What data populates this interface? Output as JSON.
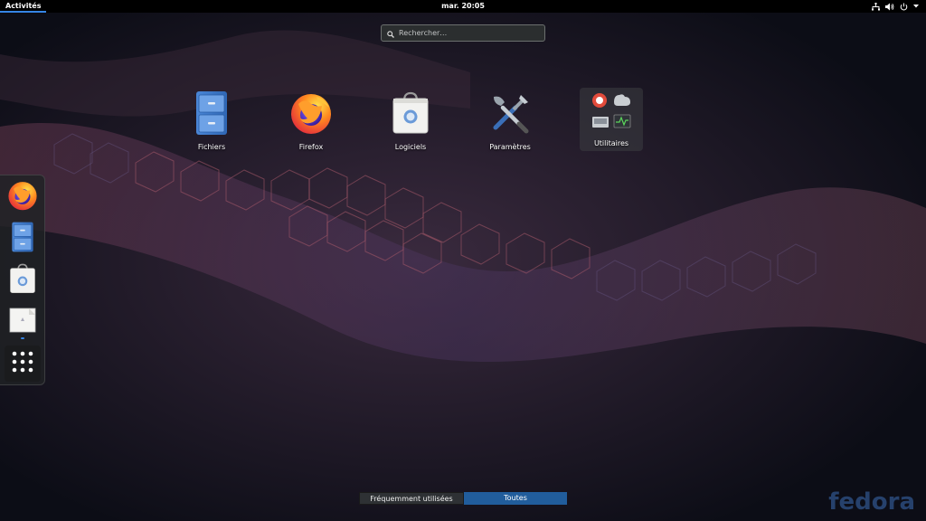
{
  "topbar": {
    "activities": "Activités",
    "clock": "mar. 20:05",
    "status_icons": [
      "network-icon",
      "volume-icon",
      "power-icon",
      "chevron-down-icon"
    ]
  },
  "search": {
    "placeholder": "Rechercher…"
  },
  "apps": [
    {
      "label": "Fichiers",
      "icon": "file-cabinet-icon"
    },
    {
      "label": "Firefox",
      "icon": "firefox-icon"
    },
    {
      "label": "Logiciels",
      "icon": "software-bag-icon"
    },
    {
      "label": "Paramètres",
      "icon": "tools-icon"
    },
    {
      "label": "Utilitaires",
      "icon": "folder-icon"
    }
  ],
  "dash": {
    "items": [
      "firefox-icon",
      "file-cabinet-icon",
      "software-bag-icon",
      "document-viewer-icon",
      "show-applications-icon"
    ]
  },
  "switcher": {
    "frequent": "Fréquemment utilisées",
    "all": "Toutes",
    "selected": "Toutes"
  },
  "watermark": "fedora",
  "colors": {
    "accent": "#3584e4",
    "selected_tab": "#215d9c",
    "topbar": "#000000"
  }
}
